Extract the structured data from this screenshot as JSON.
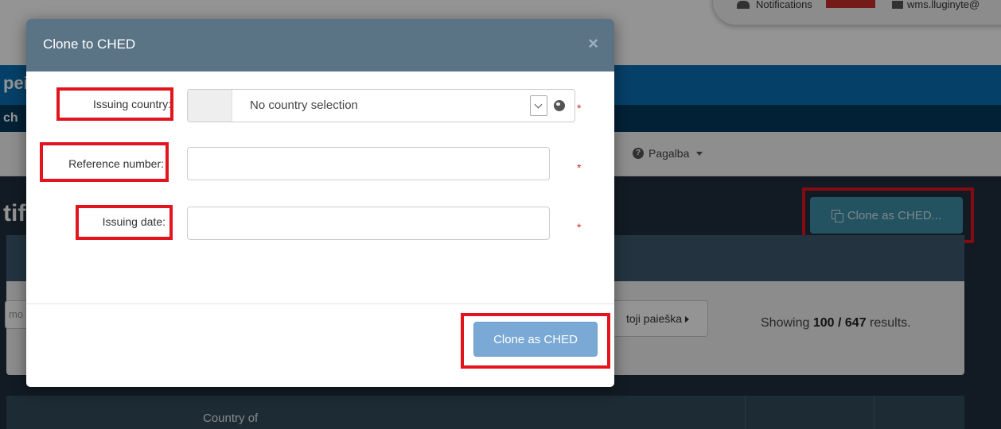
{
  "background": {
    "notifications_label": "Notifications",
    "user_label": "wms.lluginyte@",
    "band1_text": "pei",
    "band2_text": "ch",
    "nav_help_label": "Pagalba",
    "page_title": "tif",
    "clone_as_ched_button": "Clone as CHED...",
    "search_input_placeholder": "mo",
    "advanced_search_button": "toji paieška",
    "results": {
      "prefix": "Showing",
      "shown": "100",
      "separator": "/",
      "total": "647",
      "suffix": "results."
    },
    "table_header_country": "Country of"
  },
  "modal": {
    "title": "Clone to CHED",
    "close_glyph": "×",
    "fields": {
      "issuing_country": {
        "label": "Issuing country:",
        "value": "No country selection",
        "required_mark": "*"
      },
      "reference_number": {
        "label": "Reference number:",
        "value": "",
        "required_mark": "*"
      },
      "issuing_date": {
        "label": "Issuing date:",
        "value": "",
        "required_mark": "*"
      }
    },
    "submit_label": "Clone as CHED"
  },
  "annotation_color": "#e3141e"
}
